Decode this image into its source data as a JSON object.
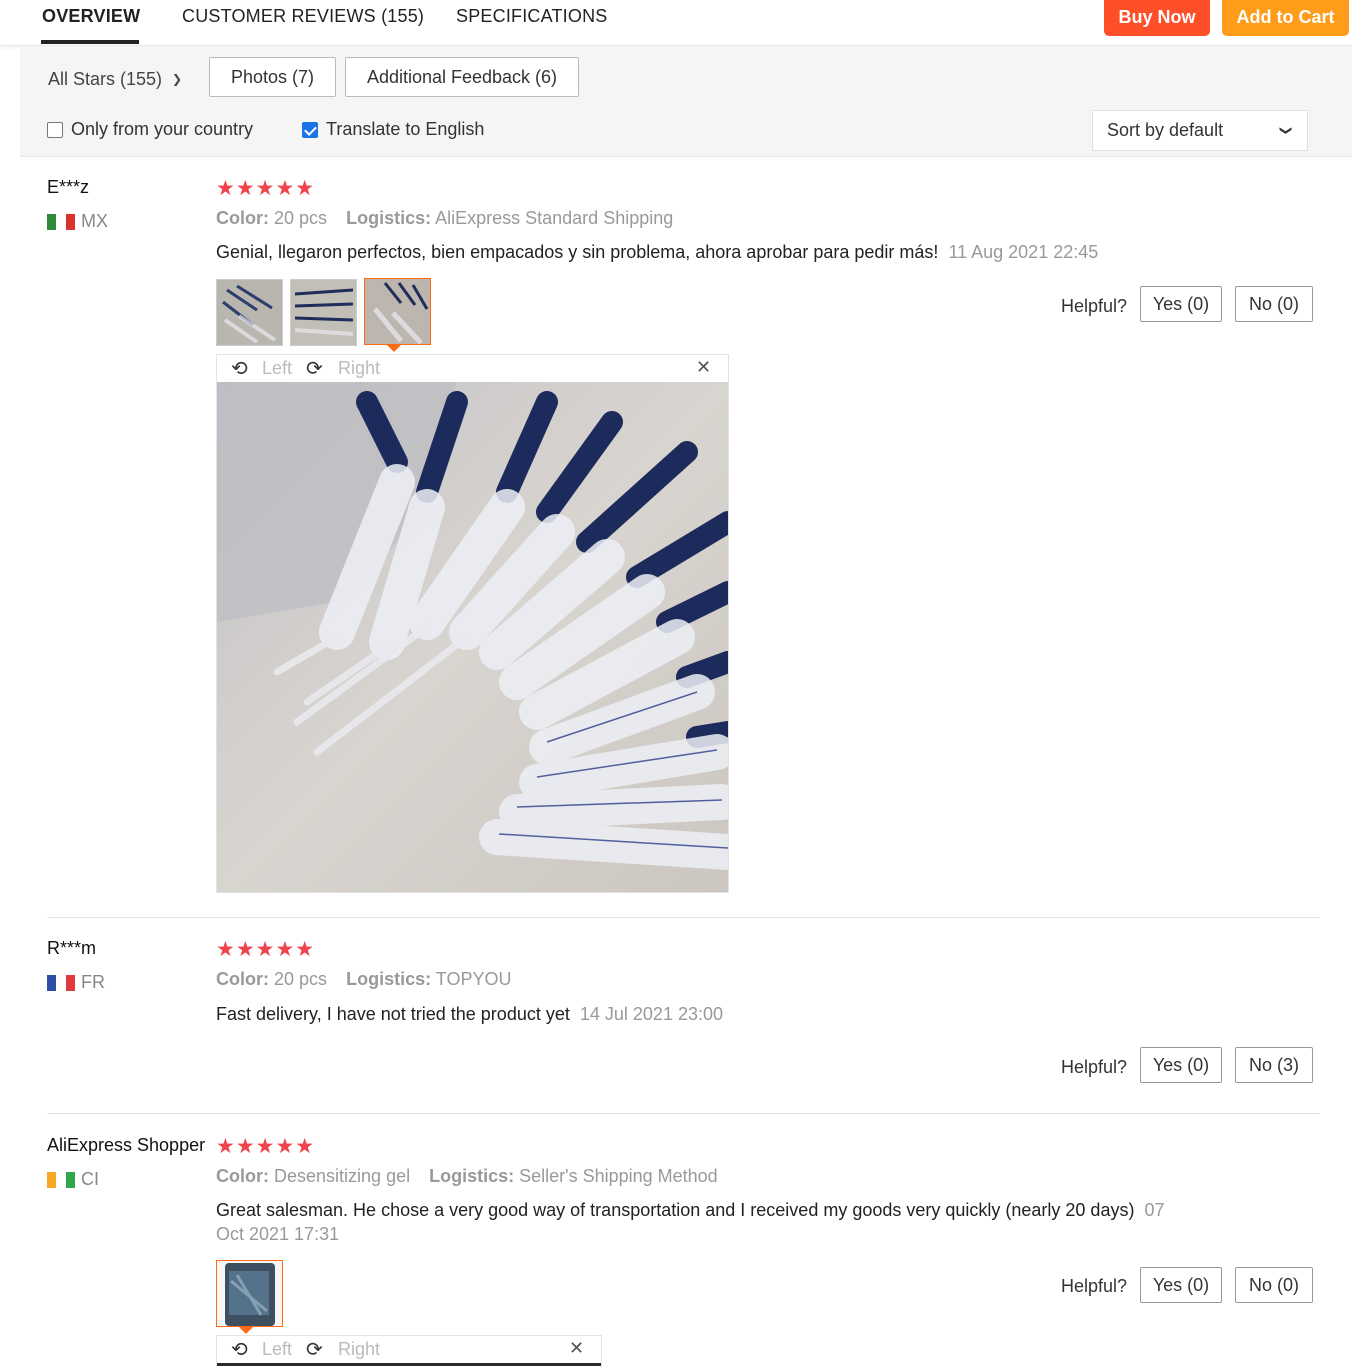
{
  "nav": {
    "tabs": [
      "OVERVIEW",
      "CUSTOMER REVIEWS (155)",
      "SPECIFICATIONS"
    ],
    "buy_now": "Buy Now",
    "add_to_cart": "Add to Cart",
    "colors": {
      "buy_now": "#ff4f28",
      "add_to_cart": "#ff9c1a"
    }
  },
  "filters": {
    "all_stars": "All Stars (155)",
    "photos": "Photos (7)",
    "additional_feedback": "Additional Feedback (6)",
    "only_country": "Only from your country",
    "only_country_checked": false,
    "translate": "Translate to English",
    "translate_checked": true,
    "sort": "Sort by default"
  },
  "labels": {
    "color": "Color:",
    "logistics": "Logistics:",
    "helpful": "Helpful?",
    "left": "Left",
    "right": "Right",
    "stars": "★★★★★"
  },
  "reviews": [
    {
      "user": "E***z",
      "country": "MX",
      "rating": 5,
      "color": "20 pcs",
      "logistics": "AliExpress Standard Shipping",
      "text": "Genial, llegaron perfectos, bien empacados y sin problema, ahora aprobar para pedir más!",
      "date": "11 Aug 2021 22:45",
      "yes": "Yes (0)",
      "no": "No (0)"
    },
    {
      "user": "R***m",
      "country": "FR",
      "rating": 5,
      "color": "20 pcs",
      "logistics": "TOPYOU",
      "text": "Fast delivery, I have not tried the product yet",
      "date": "14 Jul 2021 23:00",
      "yes": "Yes (0)",
      "no": "No (3)"
    },
    {
      "user": "AliExpress Shopper",
      "country": "CI",
      "rating": 5,
      "color": "Desensitizing gel",
      "logistics": "Seller's Shipping Method",
      "text": "Great salesman. He chose a very good way of transportation and I received my goods very quickly (nearly 20 days)",
      "date": "07 Oct 2021 17:31",
      "yes": "Yes (0)",
      "no": "No (0)"
    }
  ]
}
